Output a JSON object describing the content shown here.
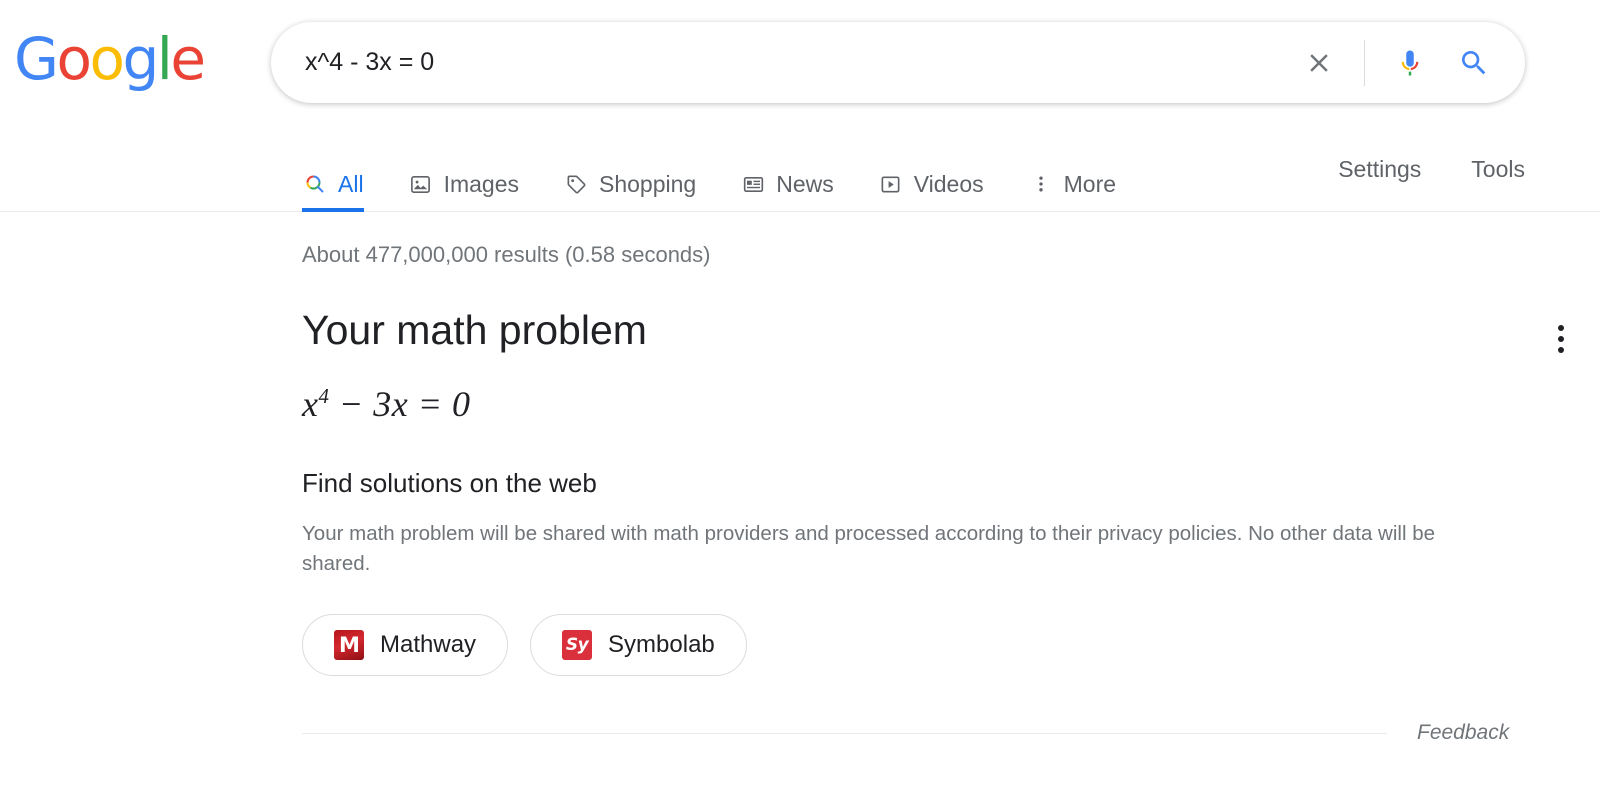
{
  "brand": {
    "logo_text": "Google",
    "letters": [
      {
        "ch": "G",
        "color": "#4285F4"
      },
      {
        "ch": "o",
        "color": "#EA4335"
      },
      {
        "ch": "o",
        "color": "#FBBC05"
      },
      {
        "ch": "g",
        "color": "#4285F4"
      },
      {
        "ch": "l",
        "color": "#34A853"
      },
      {
        "ch": "e",
        "color": "#EA4335"
      }
    ],
    "colors": {
      "blue": "#4285F4",
      "red": "#EA4335",
      "yellow": "#FBBC05",
      "green": "#34A853",
      "link_blue": "#1a73e8",
      "text": "#202124",
      "muted": "#70757a",
      "nav_text": "#5f6368",
      "border": "#dadce0"
    }
  },
  "search": {
    "query": "x^4 - 3x = 0",
    "placeholder": "Search",
    "clear_icon": "close-icon",
    "mic_icon": "microphone-icon",
    "search_icon": "search-icon"
  },
  "nav": {
    "tabs": [
      {
        "label": "All",
        "icon": "search-icon",
        "active": true
      },
      {
        "label": "Images",
        "icon": "image-icon",
        "active": false
      },
      {
        "label": "Shopping",
        "icon": "tag-icon",
        "active": false
      },
      {
        "label": "News",
        "icon": "newspaper-icon",
        "active": false
      },
      {
        "label": "Videos",
        "icon": "video-icon",
        "active": false
      },
      {
        "label": "More",
        "icon": "more-vertical-icon",
        "active": false
      }
    ],
    "right_items": [
      {
        "label": "Settings"
      },
      {
        "label": "Tools"
      }
    ]
  },
  "main": {
    "result_stats": "About 477,000,000 results (0.58 seconds)",
    "card": {
      "title": "Your math problem",
      "menu_icon": "more-vertical-icon",
      "equation": {
        "base": "x",
        "exponent": "4",
        "rest": " − 3x = 0",
        "plain": "x⁴ − 3x = 0"
      },
      "section_title": "Find solutions on the web",
      "disclaimer": "Your math problem will be shared with math providers and processed according to their privacy policies. No other data will be shared.",
      "providers": [
        {
          "label": "Mathway",
          "icon": "mathway-logo-icon",
          "glyph": "M",
          "color": "#b5141b"
        },
        {
          "label": "Symbolab",
          "icon": "symbolab-logo-icon",
          "glyph": "Sy",
          "color": "#d9303b"
        }
      ]
    }
  },
  "footer": {
    "feedback_label": "Feedback"
  }
}
